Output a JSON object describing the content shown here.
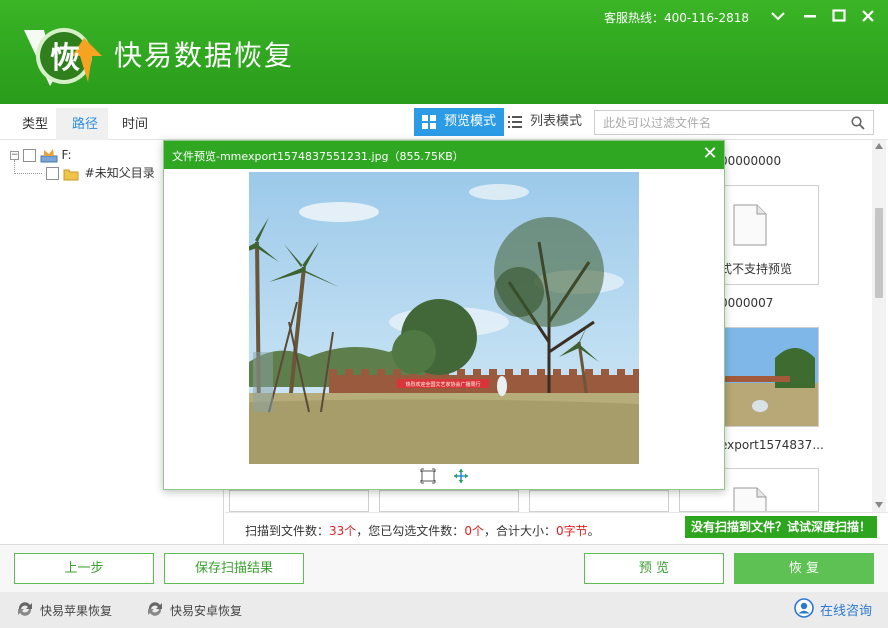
{
  "header": {
    "app_title": "快易数据恢复",
    "logo_char": "恢",
    "hotline": "客服热线：400-116-2818"
  },
  "toolbar": {
    "tabs": [
      {
        "label": "类型",
        "active": false
      },
      {
        "label": "路径",
        "active": true
      },
      {
        "label": "时间",
        "active": false
      }
    ],
    "preview_mode": "预览模式",
    "list_mode": "列表模式",
    "filter_placeholder": "此处可以过滤文件名"
  },
  "tree": {
    "drive": "F:",
    "child": "#未知父目录"
  },
  "content": {
    "top_label_partial": "00000000",
    "unsupported_preview": "式不支持预览",
    "file_name_1": "0000007",
    "file_name_2": "export1574837..."
  },
  "status": {
    "prefix": "扫描到文件数：",
    "scanned_count": "33个",
    "mid1": "，您已勾选文件数：",
    "checked_count": "0个",
    "mid2": "，合计大小：",
    "total_size": "0字节",
    "suffix": "。",
    "deep_scan": "没有扫描到文件？试试深度扫描！"
  },
  "buttons": {
    "prev": "上一步",
    "save": "保存扫描结果",
    "preview": "预 览",
    "recover": "恢 复"
  },
  "footer": {
    "apple": "快易苹果恢复",
    "android": "快易安卓恢复",
    "consult": "在线咨询"
  },
  "modal": {
    "title": "文件预览-mmexport1574837551231.jpg（855.75KB）",
    "photo_banner": "热烈欢迎全国文艺家协会广播周行"
  },
  "colors": {
    "brand_green": "#2fa723",
    "accent_blue": "#2b9be6",
    "alert_red": "#e02020"
  }
}
